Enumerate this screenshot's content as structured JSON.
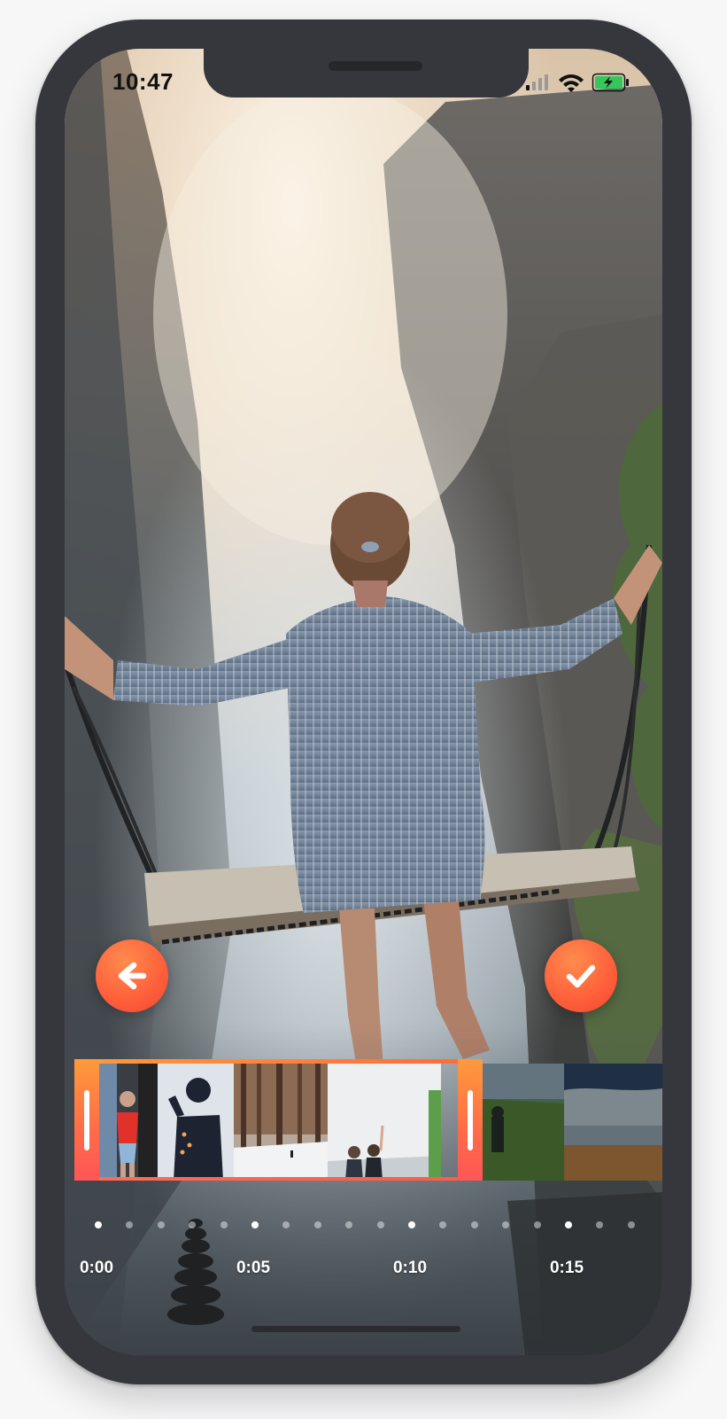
{
  "status_bar": {
    "time": "10:47",
    "icons": [
      "cellular-signal-icon",
      "wifi-icon",
      "battery-charging-icon"
    ]
  },
  "preview": {
    "description_icon": "photo-preview"
  },
  "controls": {
    "back_icon": "arrow-left-icon",
    "confirm_icon": "checkmark-icon",
    "accent_color": "#ff5e3a"
  },
  "timeline": {
    "labels": [
      "0:00",
      "0:05",
      "0:10",
      "0:15"
    ],
    "trim_start_fraction": 0.0,
    "trim_end_fraction": 0.69
  }
}
